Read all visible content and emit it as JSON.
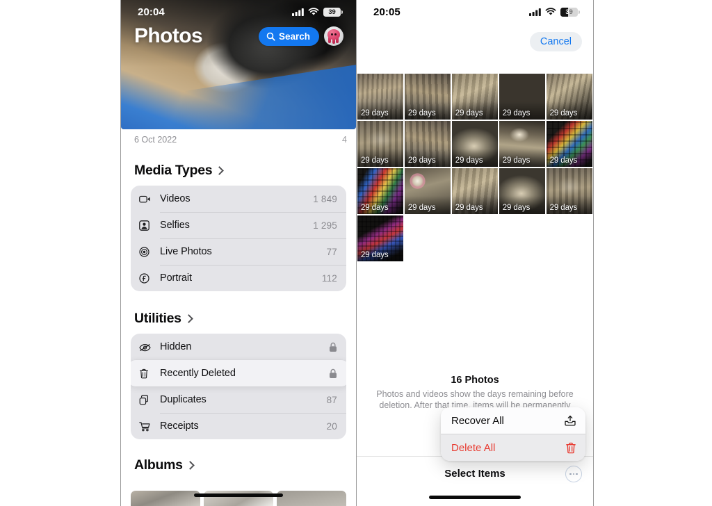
{
  "left_phone": {
    "status_bar": {
      "time": "20:04",
      "battery_level": "39",
      "cellular_icon": "cellular-bars-icon",
      "wifi_icon": "wifi-icon",
      "battery_icon": "battery-icon"
    },
    "hero": {
      "title": "Photos",
      "search_label": "Search",
      "search_icon": "search-icon",
      "avatar_icon": "octopus-memoji-avatar",
      "caption_date": "6 Oct 2022",
      "caption_count": "4"
    },
    "sections": [
      {
        "title": "Media Types",
        "chevron_icon": "chevron-right-icon",
        "rows": [
          {
            "icon": "video-camera-icon",
            "label": "Videos",
            "value": "1 849"
          },
          {
            "icon": "selfie-person-icon",
            "label": "Selfies",
            "value": "1 295"
          },
          {
            "icon": "live-photo-icon",
            "label": "Live Photos",
            "value": "77"
          },
          {
            "icon": "portrait-f-icon",
            "label": "Portrait",
            "value": "112"
          }
        ]
      },
      {
        "title": "Utilities",
        "chevron_icon": "chevron-right-icon",
        "rows": [
          {
            "icon": "eye-slash-icon",
            "label": "Hidden",
            "value": "",
            "locked": true
          },
          {
            "icon": "trash-icon",
            "label": "Recently Deleted",
            "value": "",
            "locked": true,
            "selected": true
          },
          {
            "icon": "duplicates-icon",
            "label": "Duplicates",
            "value": "87"
          },
          {
            "icon": "receipt-cart-icon",
            "label": "Receipts",
            "value": "20"
          }
        ]
      },
      {
        "title": "Albums",
        "chevron_icon": "chevron-right-icon",
        "rows": []
      }
    ]
  },
  "right_phone": {
    "status_bar": {
      "time": "20:05",
      "battery_level": "39",
      "cellular_icon": "cellular-bars-icon",
      "wifi_icon": "wifi-icon",
      "battery_icon": "battery-icon"
    },
    "nav": {
      "cancel_label": "Cancel"
    },
    "grid": {
      "badge_label": "29 days",
      "tiles": [
        {
          "style": "g1"
        },
        {
          "style": "g2"
        },
        {
          "style": "g3"
        },
        {
          "style": "g4"
        },
        {
          "style": "g5"
        },
        {
          "style": "g6"
        },
        {
          "style": "g2"
        },
        {
          "style": "g7"
        },
        {
          "style": "g8"
        },
        {
          "style": "sg1"
        },
        {
          "style": "sg2"
        },
        {
          "style": "rose"
        },
        {
          "style": "g3"
        },
        {
          "style": "g7"
        },
        {
          "style": "g6"
        },
        {
          "style": "sg3"
        }
      ]
    },
    "sheet": {
      "count_label": "16 Photos",
      "description": "Photos and videos show the days remaining before deletion. After that time, items will be permanently deleted."
    },
    "toolbar": {
      "select_items_label": "Select Items",
      "more_icon": "ellipsis-circle-icon"
    },
    "context_menu": [
      {
        "label": "Recover All",
        "icon": "tray-arrow-up-icon",
        "destructive": false
      },
      {
        "label": "Delete All",
        "icon": "trash-icon",
        "destructive": true
      }
    ]
  },
  "colors": {
    "accent_blue": "#1378f0",
    "destructive_red": "#e8392f",
    "card_gray": "#e4e4e8",
    "secondary_text": "#8e8e93"
  }
}
